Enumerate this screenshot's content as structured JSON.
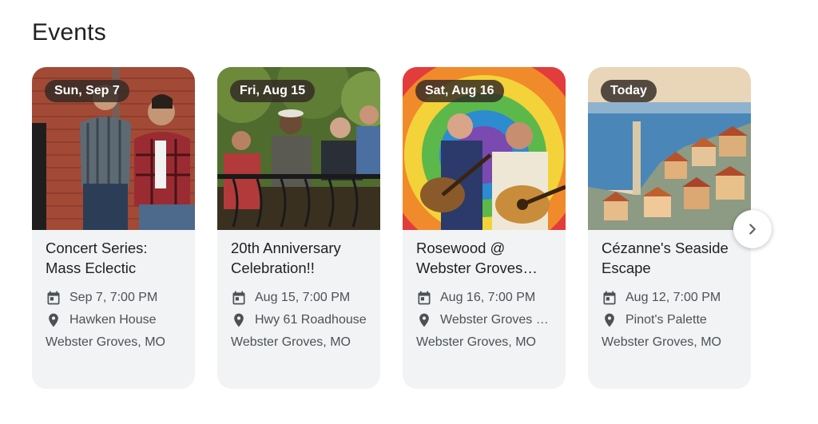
{
  "section": {
    "title": "Events"
  },
  "events": [
    {
      "badge": "Sun, Sep 7",
      "title": "Concert Series: Mass Eclectic",
      "datetime": "Sep 7, 7:00 PM",
      "venue": "Hawken House",
      "city": "Webster Groves, MO"
    },
    {
      "badge": "Fri, Aug 15",
      "title": "20th Anniversary Celebration!!",
      "datetime": "Aug 15, 7:00 PM",
      "venue": "Hwy 61 Roadhouse",
      "city": "Webster Groves, MO"
    },
    {
      "badge": "Sat, Aug 16",
      "title": "Rosewood @ Webster Groves Concert",
      "datetime": "Aug 16, 7:00 PM",
      "venue": "Webster Groves Park",
      "city": "Webster Groves, MO"
    },
    {
      "badge": "Today",
      "title": "Cézanne's Seaside Escape",
      "datetime": "Aug 12, 7:00 PM",
      "venue": "Pinot's Palette",
      "city": "Webster Groves, MO"
    }
  ],
  "icons": {
    "calendar": "calendar-icon",
    "location": "location-pin-icon",
    "next": "chevron-right-icon"
  },
  "colors": {
    "card_background": "#f1f3f4",
    "badge_background": "#3c342d",
    "text_primary": "#202124",
    "text_secondary": "#4d5156"
  }
}
